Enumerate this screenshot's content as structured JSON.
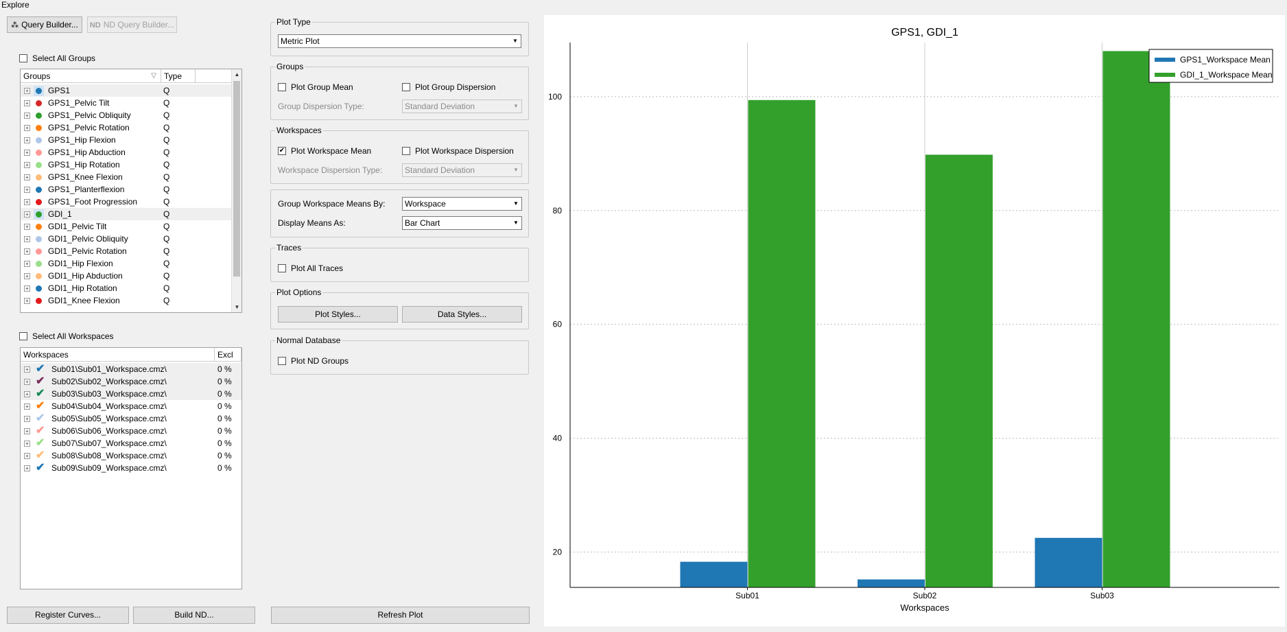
{
  "window": {
    "title": "Explore"
  },
  "toolbar": {
    "query_builder": "Query Builder...",
    "nd_query_builder": "ND Query Builder..."
  },
  "groups": {
    "select_all": "Select All Groups",
    "col_groups": "Groups",
    "col_type": "Type",
    "items": [
      {
        "name": "GPS1",
        "type": "Q",
        "color": "#1f77b4",
        "selected": true
      },
      {
        "name": "GPS1_Pelvic Tilt",
        "type": "Q",
        "color": "#d62728"
      },
      {
        "name": "GPS1_Pelvic Obliquity",
        "type": "Q",
        "color": "#2ca02c"
      },
      {
        "name": "GPS1_Pelvic Rotation",
        "type": "Q",
        "color": "#ff7f0e"
      },
      {
        "name": "GPS1_Hip Flexion",
        "type": "Q",
        "color": "#aec7e8"
      },
      {
        "name": "GPS1_Hip Abduction",
        "type": "Q",
        "color": "#ff9896"
      },
      {
        "name": "GPS1_Hip Rotation",
        "type": "Q",
        "color": "#98df8a"
      },
      {
        "name": "GPS1_Knee Flexion",
        "type": "Q",
        "color": "#ffbb78"
      },
      {
        "name": "GPS1_Planterflexion",
        "type": "Q",
        "color": "#1f77b4"
      },
      {
        "name": "GPS1_Foot Progression",
        "type": "Q",
        "color": "#e31a1c"
      },
      {
        "name": "GDI_1",
        "type": "Q",
        "color": "#2ca02c",
        "selected": true
      },
      {
        "name": "GDI1_Pelvic Tilt",
        "type": "Q",
        "color": "#ff7f0e"
      },
      {
        "name": "GDI1_Pelvic Obliquity",
        "type": "Q",
        "color": "#aec7e8"
      },
      {
        "name": "GDI1_Pelvic Rotation",
        "type": "Q",
        "color": "#ff9896"
      },
      {
        "name": "GDI1_Hip Flexion",
        "type": "Q",
        "color": "#98df8a"
      },
      {
        "name": "GDI1_Hip Abduction",
        "type": "Q",
        "color": "#ffbb78"
      },
      {
        "name": "GDI1_Hip Rotation",
        "type": "Q",
        "color": "#1f77b4"
      },
      {
        "name": "GDI1_Knee Flexion",
        "type": "Q",
        "color": "#e31a1c"
      }
    ]
  },
  "workspaces": {
    "select_all": "Select All Workspaces",
    "col_workspaces": "Workspaces",
    "col_excl": "Excl",
    "items": [
      {
        "name": "Sub01\\Sub01_Workspace.cmz\\",
        "excl": "0 %",
        "color": "#1f77b4",
        "selected": true
      },
      {
        "name": "Sub02\\Sub02_Workspace.cmz\\",
        "excl": "0 %",
        "color": "#7b2d5b",
        "selected": true
      },
      {
        "name": "Sub03\\Sub03_Workspace.cmz\\",
        "excl": "0 %",
        "color": "#1a8a5a",
        "selected": true
      },
      {
        "name": "Sub04\\Sub04_Workspace.cmz\\",
        "excl": "0 %",
        "color": "#ff7f0e"
      },
      {
        "name": "Sub05\\Sub05_Workspace.cmz\\",
        "excl": "0 %",
        "color": "#aec7e8"
      },
      {
        "name": "Sub06\\Sub06_Workspace.cmz\\",
        "excl": "0 %",
        "color": "#ff9896"
      },
      {
        "name": "Sub07\\Sub07_Workspace.cmz\\",
        "excl": "0 %",
        "color": "#98df8a"
      },
      {
        "name": "Sub08\\Sub08_Workspace.cmz\\",
        "excl": "0 %",
        "color": "#ffbb78"
      },
      {
        "name": "Sub09\\Sub09_Workspace.cmz\\",
        "excl": "0 %",
        "color": "#1f77b4"
      }
    ]
  },
  "bottom": {
    "register_curves": "Register Curves...",
    "build_nd": "Build ND...",
    "refresh_plot": "Refresh Plot"
  },
  "options": {
    "plot_type": {
      "title": "Plot Type",
      "value": "Metric Plot"
    },
    "groups": {
      "title": "Groups",
      "plot_group_mean": "Plot Group Mean",
      "plot_group_dispersion": "Plot Group Dispersion",
      "dispersion_type_label": "Group Dispersion Type:",
      "dispersion_type_value": "Standard Deviation"
    },
    "workspaces": {
      "title": "Workspaces",
      "plot_workspace_mean": "Plot Workspace Mean",
      "plot_workspace_mean_checked": true,
      "plot_workspace_dispersion": "Plot Workspace Dispersion",
      "dispersion_type_label": "Workspace Dispersion Type:",
      "dispersion_type_value": "Standard Deviation"
    },
    "means": {
      "group_by_label": "Group Workspace Means By:",
      "group_by_value": "Workspace",
      "display_as_label": "Display Means As:",
      "display_as_value": "Bar Chart"
    },
    "traces": {
      "title": "Traces",
      "plot_all_traces": "Plot All Traces"
    },
    "plot_options": {
      "title": "Plot Options",
      "plot_styles": "Plot Styles...",
      "data_styles": "Data Styles..."
    },
    "normal_db": {
      "title": "Normal Database",
      "plot_nd_groups": "Plot ND Groups"
    }
  },
  "chart_data": {
    "type": "bar",
    "title": "GPS1, GDI_1",
    "xlabel": "Workspaces",
    "ylabel": "",
    "categories": [
      "Sub01",
      "Sub02",
      "Sub03"
    ],
    "series": [
      {
        "name": "GPS1_Workspace Mean",
        "color": "#1f77b4",
        "values": [
          18.3,
          15.2,
          22.5
        ]
      },
      {
        "name": "GDI_1_Workspace Mean",
        "color": "#33a02c",
        "values": [
          99.4,
          89.8,
          108.0
        ]
      }
    ],
    "ylim": [
      13.8,
      109.5
    ],
    "yticks": [
      20,
      40,
      60,
      80,
      100
    ],
    "legend": "top-right",
    "grid": true
  }
}
